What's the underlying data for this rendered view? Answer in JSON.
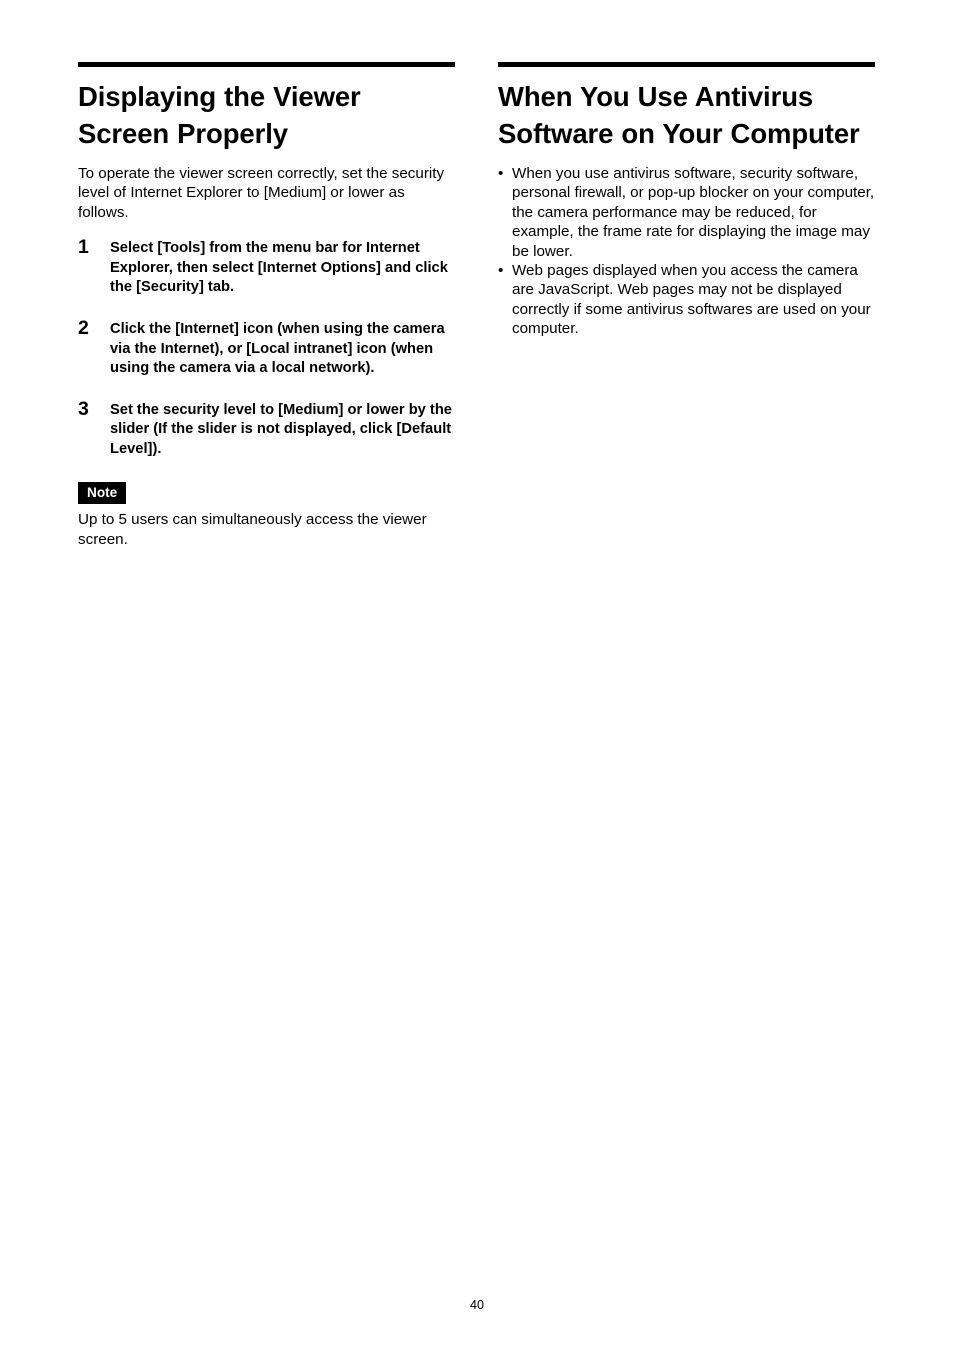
{
  "page": {
    "number": "40"
  },
  "left_column": {
    "heading": "Displaying the Viewer Screen Properly",
    "intro": "To operate the viewer screen correctly, set the security level of Internet Explorer to [Medium] or lower as follows.",
    "steps": [
      {
        "number": "1",
        "text": "Select [Tools] from the menu bar for Internet Explorer, then select [Internet Options] and click the [Security] tab."
      },
      {
        "number": "2",
        "text": "Click the [Internet] icon (when using the camera via the Internet), or [Local intranet] icon (when using the camera via a local network)."
      },
      {
        "number": "3",
        "text": "Set the security level to [Medium] or lower by the slider (If the slider is not displayed, click [Default Level])."
      }
    ],
    "note": {
      "label": "Note",
      "text": "Up to 5 users can simultaneously access the viewer screen."
    }
  },
  "right_column": {
    "heading": "When You Use Antivirus Software on Your Computer",
    "bullet_marker": "•",
    "bullets": [
      "When you use antivirus software, security software, personal firewall, or pop-up blocker on your computer, the camera performance may be reduced, for example, the frame rate for displaying the image may be lower.",
      "Web pages displayed when you access the camera are JavaScript. Web pages may not be displayed correctly if some antivirus softwares are used on your computer."
    ]
  }
}
